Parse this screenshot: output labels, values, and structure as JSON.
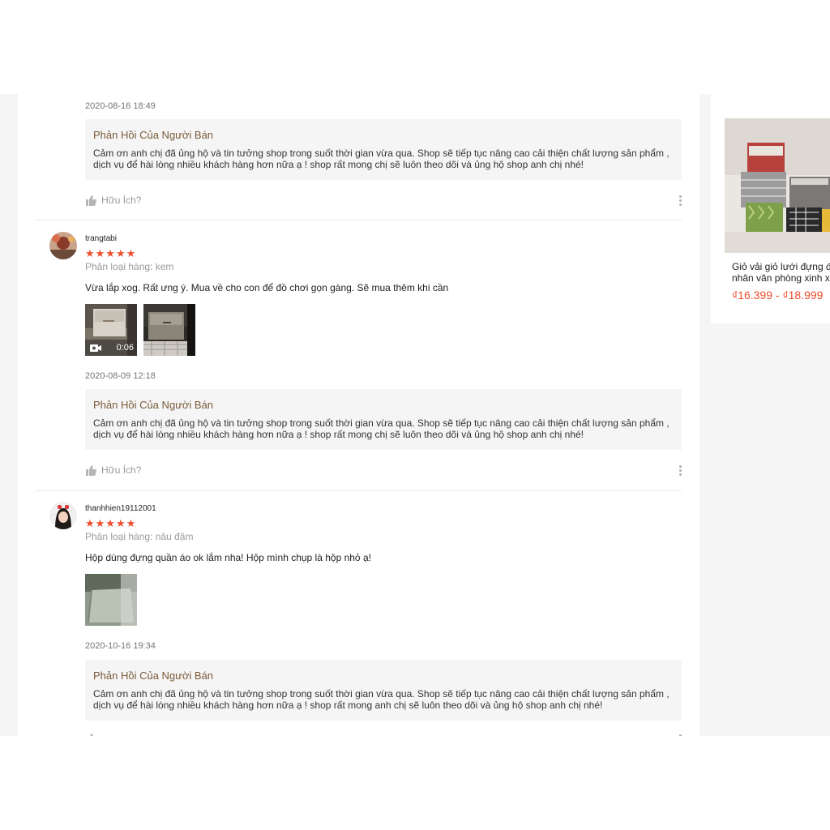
{
  "reply_title": "Phản Hồi Của Người Bán",
  "helpful_label": "Hữu Ích?",
  "reviews": [
    {
      "timestamp": "2020-08-16 18:49",
      "reply_text": "Cảm ơn anh chị đã ủng hộ và tin tưởng shop trong suốt thời gian vừa qua. Shop sẽ tiếp tục nâng cao cải thiện chất lượng sản phẩm , dịch vụ để hài lòng nhiều khách hàng hơn nữa ạ ! shop  rất mong chị sẽ luôn theo dõi và ủng hộ shop anh chị nhé!"
    },
    {
      "username": "trangtabi",
      "stars": "★★★★★",
      "rating": 5,
      "variant": "Phân loại hàng: kem",
      "comment": "Vừa lắp xog. Rất ưng ý. Mua về cho con để đồ chơi gọn gàng. Sẽ mua thêm khi cần",
      "video_duration": "0:06",
      "timestamp": "2020-08-09 12:18",
      "reply_text": "Cảm ơn anh chị đã ủng hộ và tin tưởng shop trong suốt thời gian vừa qua. Shop sẽ tiếp tục nâng cao cải thiện chất lượng sản phẩm , dịch vụ để hài lòng nhiều khách hàng hơn nữa ạ ! shop  rất mong chị sẽ luôn theo dõi và ủng hộ shop anh chị nhé!"
    },
    {
      "username": "thanhhien19112001",
      "stars": "★★★★★",
      "rating": 5,
      "variant": "Phân loại hàng: nâu đậm",
      "comment": "Hộp dùng đựng quần áo ok lắm nha! Hộp mình chụp là hộp nhỏ ạ!",
      "timestamp": "2020-10-16 19:34",
      "reply_text": "Cảm ơn anh chị đã ủng hộ và tin tưởng shop trong suốt thời gian vừa qua. Shop sẽ tiếp tục nâng cao cải thiện chất lượng sản phẩm , dịch vụ để hài lòng nhiều khách hàng hơn nữa ạ ! shop rất mong anh chị sẽ luôn theo dõi và ủng hộ shop anh chị nhé!"
    }
  ],
  "sidebar": {
    "product_name": "Giỏ vải giỏ lưới đựng đồ nhân văn phòng xinh xắn",
    "price": "₫16.399 - ₫18.999"
  },
  "colors": {
    "accent": "#ee4d2d",
    "reply_title": "#7a5a3a"
  }
}
